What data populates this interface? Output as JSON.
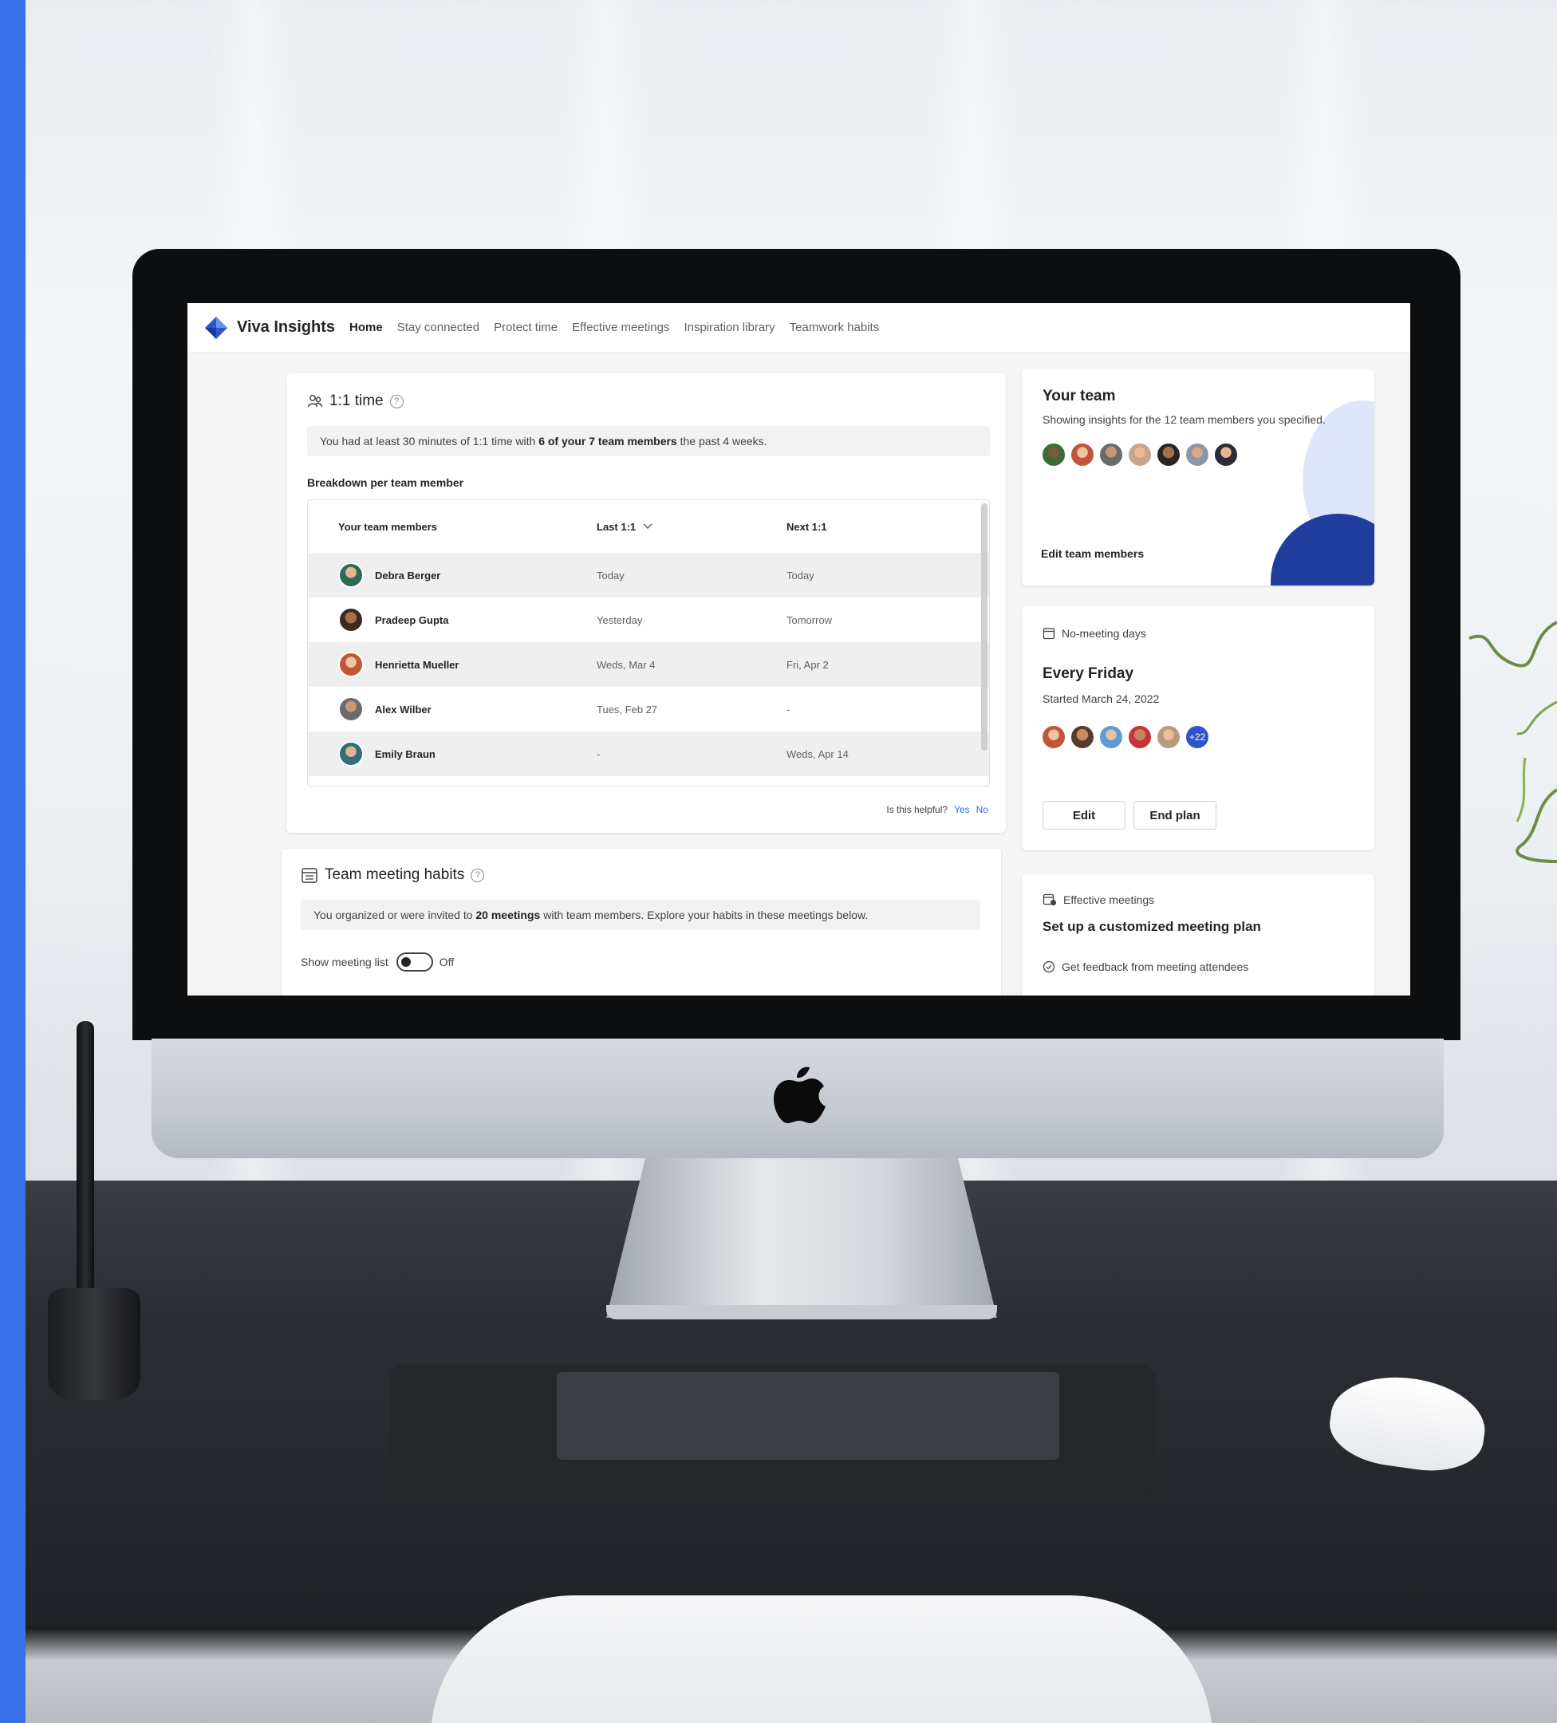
{
  "app": {
    "title": "Viva Insights",
    "nav": [
      "Home",
      "Stay connected",
      "Protect time",
      "Effective meetings",
      "Inspiration library",
      "Teamwork habits"
    ],
    "active_nav": "Home"
  },
  "one_on_one": {
    "title": "1:1 time",
    "summary_prefix": "You had at least 30 minutes of 1:1 time with ",
    "summary_bold": "6 of your 7 team members",
    "summary_suffix": " the past 4 weeks.",
    "breakdown_heading": "Breakdown per team member",
    "columns": [
      "Your team members",
      "Last 1:1",
      "Next 1:1"
    ],
    "rows": [
      {
        "name": "Debra Berger",
        "last": "Today",
        "next": "Today"
      },
      {
        "name": "Pradeep Gupta",
        "last": "Yesterday",
        "next": "Tomorrow"
      },
      {
        "name": "Henrietta Mueller",
        "last": "Weds, Mar 4",
        "next": "Fri, Apr 2"
      },
      {
        "name": "Alex Wilber",
        "last": "Tues, Feb 27",
        "next": "-"
      },
      {
        "name": "Emily Braun",
        "last": "-",
        "next": "Weds, Apr 14"
      }
    ],
    "feedback_question": "Is this helpful?",
    "feedback_yes": "Yes",
    "feedback_no": "No"
  },
  "team_meeting_habits": {
    "title": "Team meeting habits",
    "summary_prefix": "You organized or were invited to ",
    "summary_bold": "20 meetings",
    "summary_suffix": " with team members. Explore your habits in these meetings below.",
    "toggle_label": "Show meeting list",
    "toggle_state": "Off"
  },
  "your_team": {
    "title": "Your team",
    "subtitle": "Showing insights for the 12 team members you specified.",
    "edit_link": "Edit team members"
  },
  "no_meeting_days": {
    "label": "No-meeting days",
    "title": "Every Friday",
    "started": "Started March 24, 2022",
    "more_count": "+22",
    "edit_button": "Edit",
    "end_button": "End plan"
  },
  "effective_meetings": {
    "label": "Effective meetings",
    "title": "Set up a customized meeting plan",
    "item": "Get feedback from meeting attendees"
  },
  "colors": {
    "accent": "#2f6bd8",
    "brand_strip": "#3b71e8",
    "team_decor_dark": "#1f3d9c",
    "team_decor_light": "#dfe6fb"
  }
}
